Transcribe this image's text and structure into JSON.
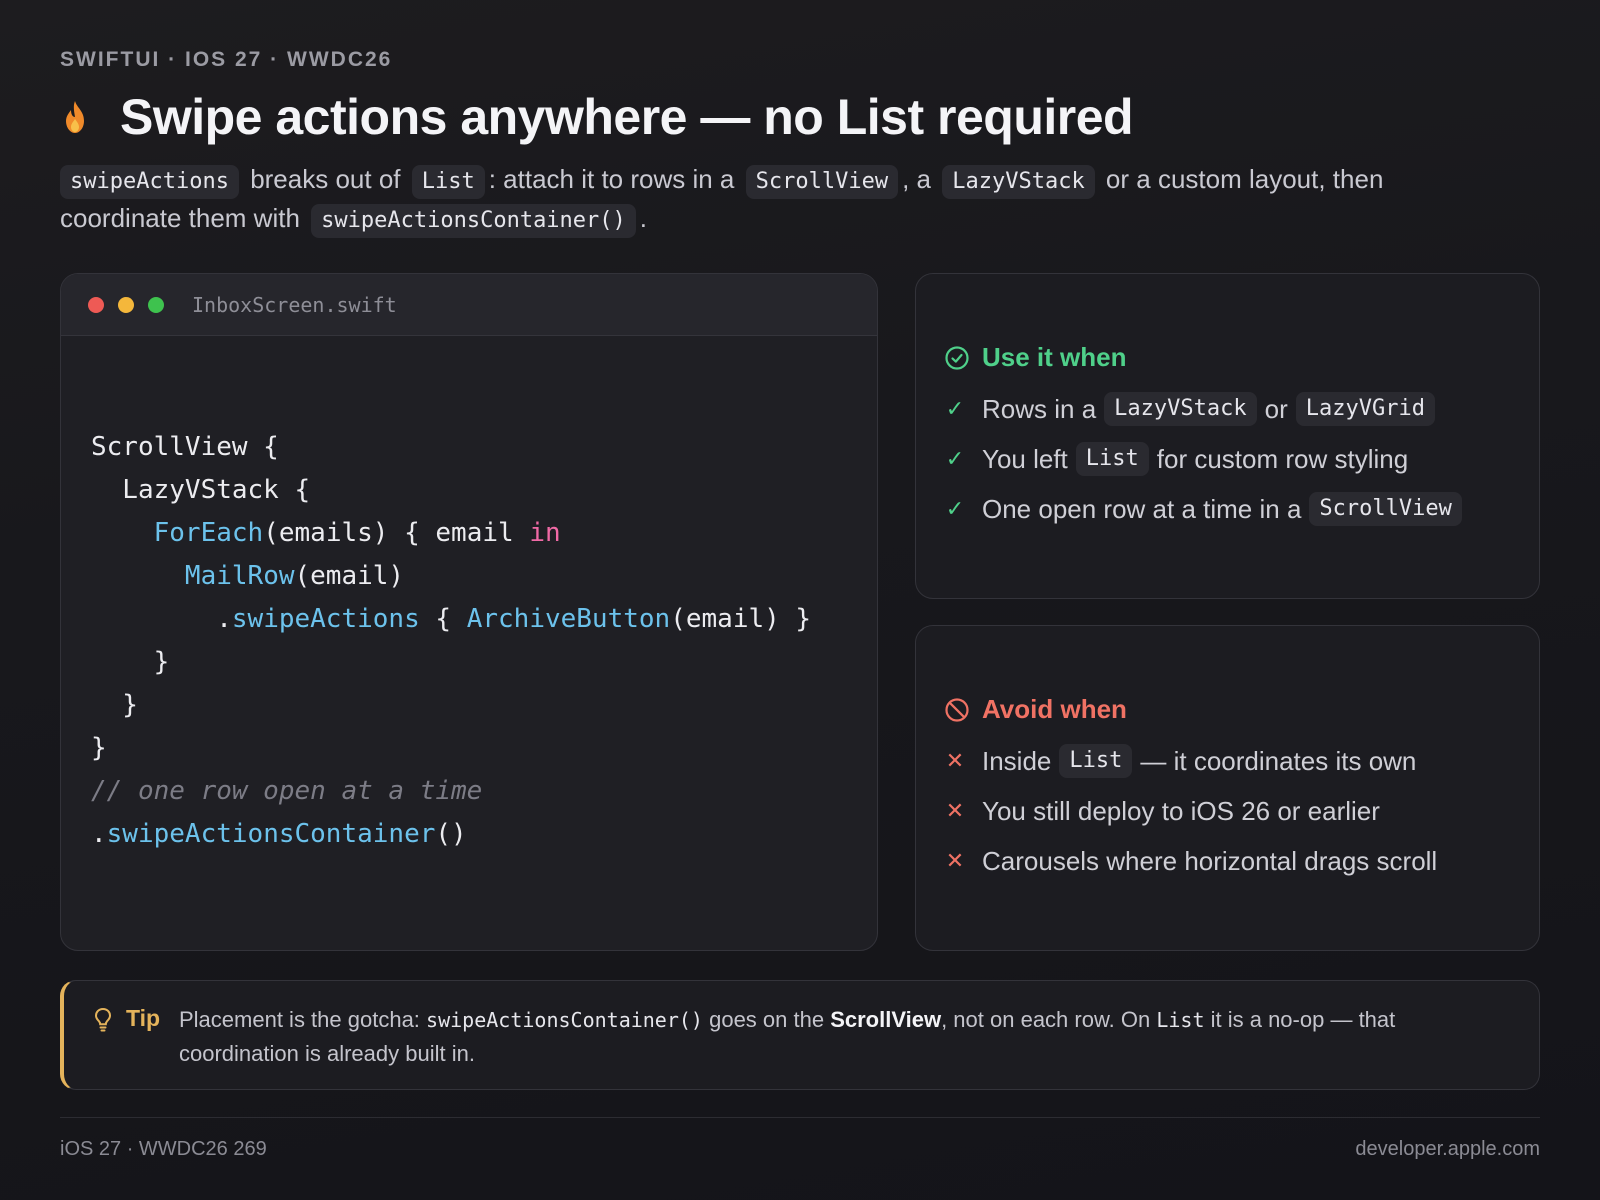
{
  "header": {
    "eyebrow": "SWIFTUI · IOS 27 · WWDC26",
    "title": "Swipe actions anywhere — no List required",
    "icon": "flame-icon"
  },
  "intro": {
    "p1_code": "swipeActions",
    "p1_t1": "breaks out of",
    "p1_code2": "List",
    "p1_t2": ": attach it to rows in a",
    "p1_code3": "ScrollView",
    "p1_t3": ", a",
    "p1_code4": "LazyVStack",
    "p1_t4": "or a custom layout, then coordinate them with",
    "p1_code5": "swipeActionsContainer()",
    "p1_t5": "."
  },
  "code_card": {
    "filename": "InboxScreen.swift",
    "lines": {
      "l1": "ScrollView {",
      "l2": "  LazyVStack {",
      "l3_fn": "ForEach",
      "l3_rest": "(emails) { email ",
      "l3_kw": "in",
      "l4_fn": "MailRow",
      "l4_rest": "(email)",
      "l5_dot": ".",
      "l5_fn": "swipeActions",
      "l5_mid": " { ",
      "l5_fn2": "ArchiveButton",
      "l5_rest": "(email) }",
      "l6": "    }",
      "l7": "  }",
      "l8": "}",
      "l9_comment": "// one row open at a time",
      "l10_dot": ".",
      "l10_fn": "swipeActionsContainer",
      "l10_rest": "()"
    }
  },
  "use_card": {
    "heading": "Use it when",
    "items": {
      "i1_t1": "Rows in a",
      "i1_c1": "LazyVStack",
      "i1_t2": "or",
      "i1_c2": "LazyVGrid",
      "i2_t1": "You left",
      "i2_c1": "List",
      "i2_t2": "for custom row styling",
      "i3_t1": "One open row at a time in a",
      "i3_c1": "ScrollView"
    }
  },
  "avoid_card": {
    "heading": "Avoid when",
    "items": {
      "i1_t1": "Inside",
      "i1_c1": "List",
      "i1_t2": "— it coordinates its own",
      "i2_t1": "You still deploy to iOS 26 or earlier",
      "i3_t1": "Carousels where horizontal drags scroll"
    }
  },
  "tip": {
    "label": "Tip",
    "t1": "Placement is the gotcha: ",
    "c1": "swipeActionsContainer()",
    "t2": " goes on the ",
    "b1": "ScrollView",
    "t3": ", not on each row. On ",
    "c2": "List",
    "t4": " it is a no-op — that coordination is already built in."
  },
  "footer": {
    "left": "iOS 27 · WWDC26 269",
    "right": "developer.apple.com"
  },
  "colors": {
    "accent_green": "#4fd08a",
    "accent_red": "#f07264",
    "accent_tip": "#e4b35b",
    "code_keyword": "#f06aa6",
    "code_function": "#6cc2ec"
  }
}
